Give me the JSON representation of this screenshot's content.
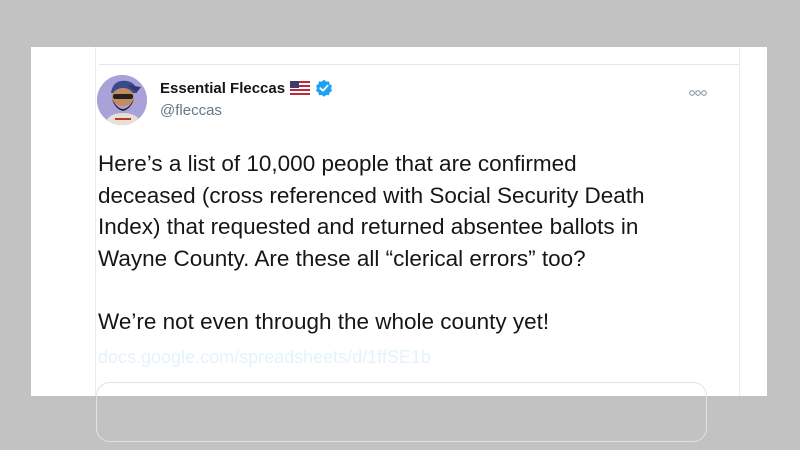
{
  "tweet": {
    "display_name": "Essential Fleccas",
    "handle": "@fleccas",
    "badges": [
      "flag-usa-icon",
      "verified-badge-icon"
    ],
    "lines": [
      "Here’s a list of 10,000 people that are confirmed",
      "deceased (cross referenced with Social Security Death",
      "Index) that requested and returned absentee ballots in",
      "Wayne County. Are these all “clerical errors” too?",
      "",
      "We’re not even through the whole county yet!"
    ],
    "link_text": "docs.google.com/spreadsheets/d/1ffSE1b"
  },
  "colors": {
    "background": "#c3c2c2",
    "card": "#ffffff",
    "text": "#14171a",
    "secondary_text": "#657786",
    "verified": "#1da1f2",
    "avatar_bg": "#a9a2d8"
  }
}
